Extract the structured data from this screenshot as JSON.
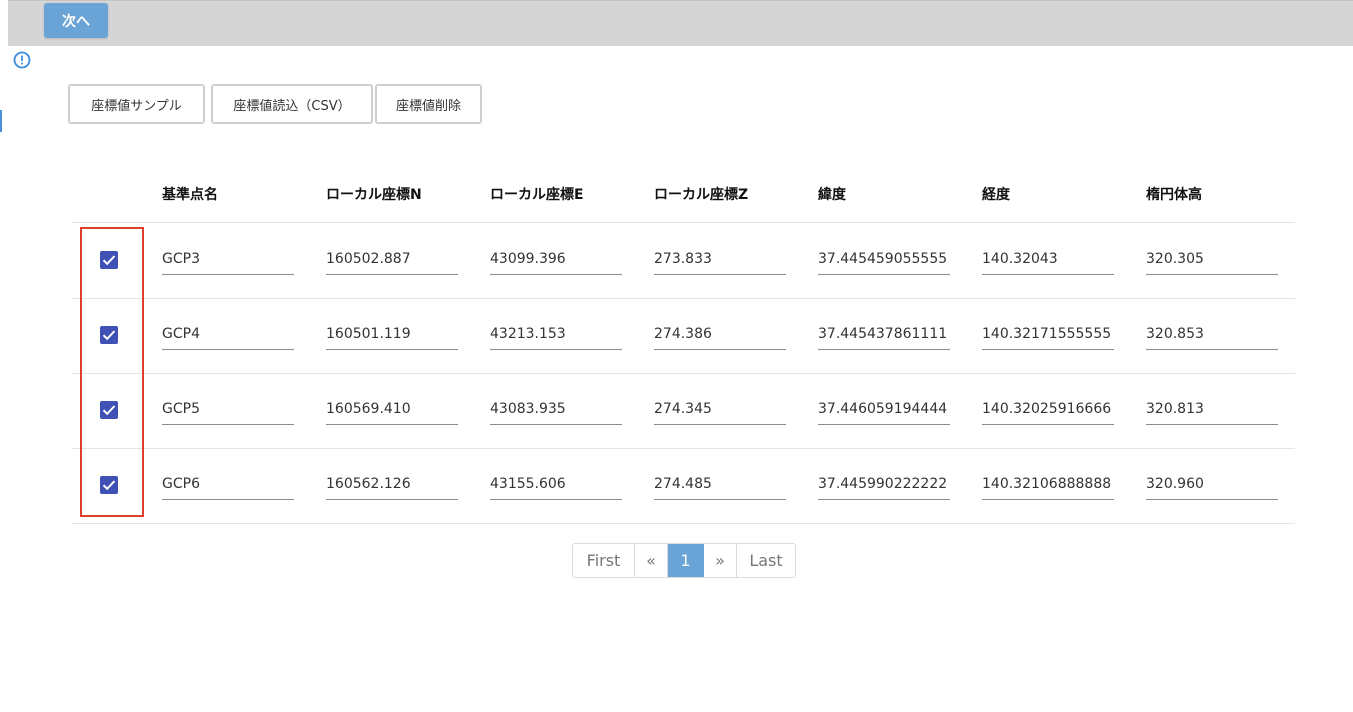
{
  "topbar": {
    "next_label": "次へ"
  },
  "toolbar": {
    "sample_label": "座標値サンプル",
    "import_label": "座標値読込（CSV）",
    "delete_label": "座標値削除"
  },
  "table": {
    "headers": [
      "基準点名",
      "ローカル座標N",
      "ローカル座標E",
      "ローカル座標Z",
      "緯度",
      "経度",
      "楕円体高"
    ],
    "rows": [
      {
        "checked": true,
        "cells": [
          "GCP3",
          "160502.887",
          "43099.396",
          "273.833",
          "37.445459055555",
          "140.32043",
          "320.305"
        ]
      },
      {
        "checked": true,
        "cells": [
          "GCP4",
          "160501.119",
          "43213.153",
          "274.386",
          "37.445437861111",
          "140.32171555555",
          "320.853"
        ]
      },
      {
        "checked": true,
        "cells": [
          "GCP5",
          "160569.410",
          "43083.935",
          "274.345",
          "37.446059194444",
          "140.32025916666",
          "320.813"
        ]
      },
      {
        "checked": true,
        "cells": [
          "GCP6",
          "160562.126",
          "43155.606",
          "274.485",
          "37.445990222222",
          "140.32106888888",
          "320.960"
        ]
      }
    ]
  },
  "pagination": {
    "first": "First",
    "prev": "«",
    "current": "1",
    "next": "»",
    "last": "Last"
  },
  "colors": {
    "accent": "#6aa4d6",
    "checkbox": "#3f51b5",
    "highlight": "#e03e2d"
  }
}
